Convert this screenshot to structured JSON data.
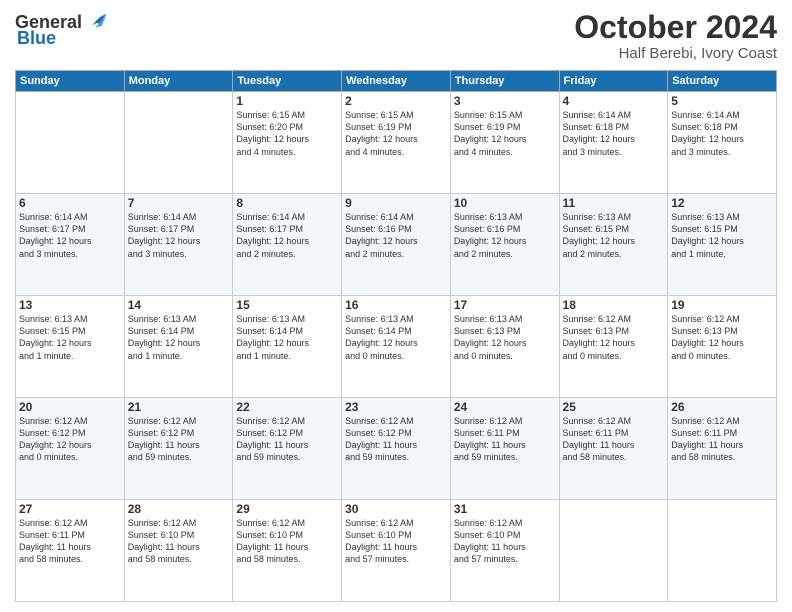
{
  "header": {
    "logo": {
      "text_general": "General",
      "text_blue": "Blue"
    },
    "month_title": "October 2024",
    "location": "Half Berebi, Ivory Coast"
  },
  "weekdays": [
    "Sunday",
    "Monday",
    "Tuesday",
    "Wednesday",
    "Thursday",
    "Friday",
    "Saturday"
  ],
  "weeks": [
    [
      {
        "day": "",
        "detail": ""
      },
      {
        "day": "",
        "detail": ""
      },
      {
        "day": "1",
        "detail": "Sunrise: 6:15 AM\nSunset: 6:20 PM\nDaylight: 12 hours\nand 4 minutes."
      },
      {
        "day": "2",
        "detail": "Sunrise: 6:15 AM\nSunset: 6:19 PM\nDaylight: 12 hours\nand 4 minutes."
      },
      {
        "day": "3",
        "detail": "Sunrise: 6:15 AM\nSunset: 6:19 PM\nDaylight: 12 hours\nand 4 minutes."
      },
      {
        "day": "4",
        "detail": "Sunrise: 6:14 AM\nSunset: 6:18 PM\nDaylight: 12 hours\nand 3 minutes."
      },
      {
        "day": "5",
        "detail": "Sunrise: 6:14 AM\nSunset: 6:18 PM\nDaylight: 12 hours\nand 3 minutes."
      }
    ],
    [
      {
        "day": "6",
        "detail": "Sunrise: 6:14 AM\nSunset: 6:17 PM\nDaylight: 12 hours\nand 3 minutes."
      },
      {
        "day": "7",
        "detail": "Sunrise: 6:14 AM\nSunset: 6:17 PM\nDaylight: 12 hours\nand 3 minutes."
      },
      {
        "day": "8",
        "detail": "Sunrise: 6:14 AM\nSunset: 6:17 PM\nDaylight: 12 hours\nand 2 minutes."
      },
      {
        "day": "9",
        "detail": "Sunrise: 6:14 AM\nSunset: 6:16 PM\nDaylight: 12 hours\nand 2 minutes."
      },
      {
        "day": "10",
        "detail": "Sunrise: 6:13 AM\nSunset: 6:16 PM\nDaylight: 12 hours\nand 2 minutes."
      },
      {
        "day": "11",
        "detail": "Sunrise: 6:13 AM\nSunset: 6:15 PM\nDaylight: 12 hours\nand 2 minutes."
      },
      {
        "day": "12",
        "detail": "Sunrise: 6:13 AM\nSunset: 6:15 PM\nDaylight: 12 hours\nand 1 minute."
      }
    ],
    [
      {
        "day": "13",
        "detail": "Sunrise: 6:13 AM\nSunset: 6:15 PM\nDaylight: 12 hours\nand 1 minute."
      },
      {
        "day": "14",
        "detail": "Sunrise: 6:13 AM\nSunset: 6:14 PM\nDaylight: 12 hours\nand 1 minute."
      },
      {
        "day": "15",
        "detail": "Sunrise: 6:13 AM\nSunset: 6:14 PM\nDaylight: 12 hours\nand 1 minute."
      },
      {
        "day": "16",
        "detail": "Sunrise: 6:13 AM\nSunset: 6:14 PM\nDaylight: 12 hours\nand 0 minutes."
      },
      {
        "day": "17",
        "detail": "Sunrise: 6:13 AM\nSunset: 6:13 PM\nDaylight: 12 hours\nand 0 minutes."
      },
      {
        "day": "18",
        "detail": "Sunrise: 6:12 AM\nSunset: 6:13 PM\nDaylight: 12 hours\nand 0 minutes."
      },
      {
        "day": "19",
        "detail": "Sunrise: 6:12 AM\nSunset: 6:13 PM\nDaylight: 12 hours\nand 0 minutes."
      }
    ],
    [
      {
        "day": "20",
        "detail": "Sunrise: 6:12 AM\nSunset: 6:12 PM\nDaylight: 12 hours\nand 0 minutes."
      },
      {
        "day": "21",
        "detail": "Sunrise: 6:12 AM\nSunset: 6:12 PM\nDaylight: 11 hours\nand 59 minutes."
      },
      {
        "day": "22",
        "detail": "Sunrise: 6:12 AM\nSunset: 6:12 PM\nDaylight: 11 hours\nand 59 minutes."
      },
      {
        "day": "23",
        "detail": "Sunrise: 6:12 AM\nSunset: 6:12 PM\nDaylight: 11 hours\nand 59 minutes."
      },
      {
        "day": "24",
        "detail": "Sunrise: 6:12 AM\nSunset: 6:11 PM\nDaylight: 11 hours\nand 59 minutes."
      },
      {
        "day": "25",
        "detail": "Sunrise: 6:12 AM\nSunset: 6:11 PM\nDaylight: 11 hours\nand 58 minutes."
      },
      {
        "day": "26",
        "detail": "Sunrise: 6:12 AM\nSunset: 6:11 PM\nDaylight: 11 hours\nand 58 minutes."
      }
    ],
    [
      {
        "day": "27",
        "detail": "Sunrise: 6:12 AM\nSunset: 6:11 PM\nDaylight: 11 hours\nand 58 minutes."
      },
      {
        "day": "28",
        "detail": "Sunrise: 6:12 AM\nSunset: 6:10 PM\nDaylight: 11 hours\nand 58 minutes."
      },
      {
        "day": "29",
        "detail": "Sunrise: 6:12 AM\nSunset: 6:10 PM\nDaylight: 11 hours\nand 58 minutes."
      },
      {
        "day": "30",
        "detail": "Sunrise: 6:12 AM\nSunset: 6:10 PM\nDaylight: 11 hours\nand 57 minutes."
      },
      {
        "day": "31",
        "detail": "Sunrise: 6:12 AM\nSunset: 6:10 PM\nDaylight: 11 hours\nand 57 minutes."
      },
      {
        "day": "",
        "detail": ""
      },
      {
        "day": "",
        "detail": ""
      }
    ]
  ]
}
